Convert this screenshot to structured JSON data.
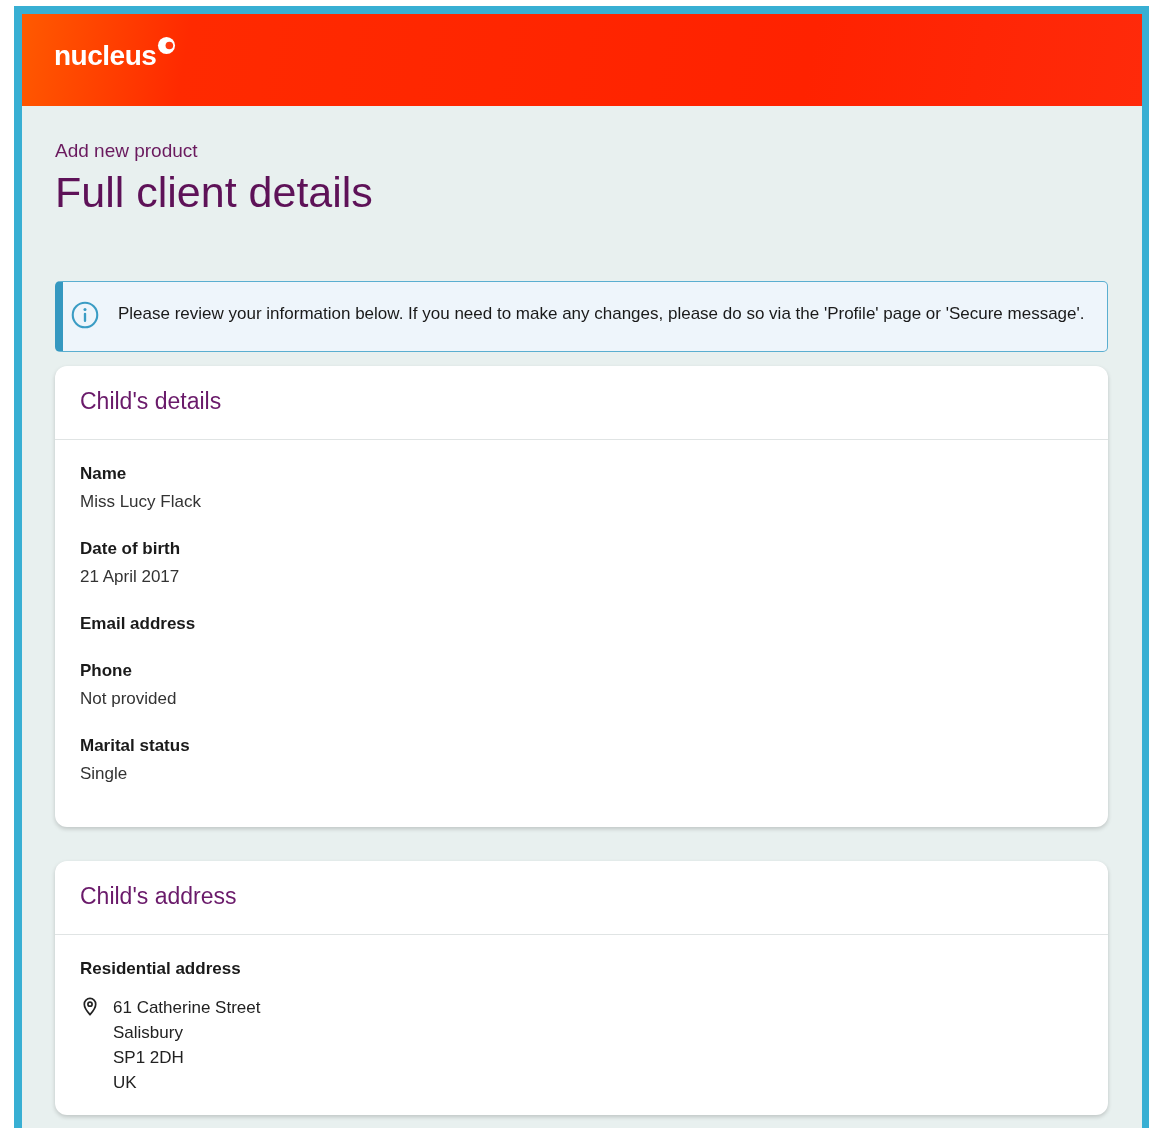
{
  "header": {
    "logo": "nucleus"
  },
  "page": {
    "eyebrow": "Add new product",
    "title": "Full client details"
  },
  "notice": {
    "text": "Please review your information below. If you need to make any changes, please do so via the 'Profile' page or 'Secure message'."
  },
  "sections": [
    {
      "title": "Child's details",
      "kind": "fields",
      "fields": [
        {
          "label": "Name",
          "value": "Miss Lucy Flack"
        },
        {
          "label": "Date of birth",
          "value": "21 April 2017"
        },
        {
          "label": "Email address"
        },
        {
          "label": "Phone",
          "value": "Not provided"
        },
        {
          "label": "Marital status",
          "value": "Single"
        }
      ]
    },
    {
      "title": "Child's address",
      "kind": "address",
      "label": "Residential address",
      "lines": [
        "61 Catherine Street",
        "Salisbury",
        "SP1 2DH",
        "UK"
      ]
    }
  ]
}
